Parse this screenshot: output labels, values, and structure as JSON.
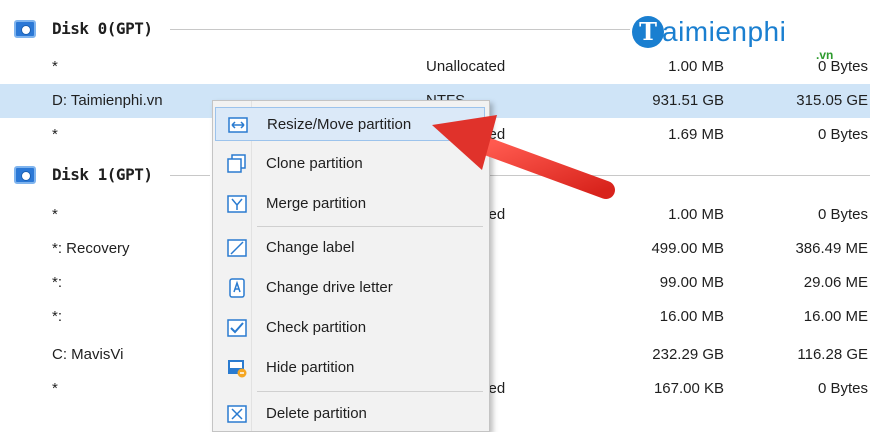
{
  "logo": {
    "mark": "T",
    "text": "aimienphi",
    "sub": ".vn"
  },
  "disks": [
    {
      "title": "Disk 0(GPT)",
      "rows": [
        {
          "name": "*",
          "fs": "Unallocated",
          "capacity": "1.00 MB",
          "used": "0 Bytes"
        },
        {
          "name": "D: Taimienphi.vn",
          "fs": "NTFS",
          "capacity": "931.51 GB",
          "used": "315.05 GE",
          "selected": true
        },
        {
          "name": "*",
          "fs": "Unallocated",
          "capacity": "1.69 MB",
          "used": "0 Bytes"
        }
      ]
    },
    {
      "title": "Disk 1(GPT)",
      "rows": [
        {
          "name": "*",
          "fs": "Unallocated",
          "capacity": "1.00 MB",
          "used": "0 Bytes"
        },
        {
          "name": "*: Recovery",
          "fs": "",
          "capacity": "499.00 MB",
          "used": "386.49 ME"
        },
        {
          "name": "*:",
          "fs": "",
          "capacity": "99.00 MB",
          "used": "29.06 ME"
        },
        {
          "name": "*:",
          "fs": "",
          "capacity": "16.00 MB",
          "used": "16.00 ME"
        },
        {
          "name": "C: MavisVi",
          "fs": "",
          "capacity": "232.29 GB",
          "used": "116.28 GE"
        },
        {
          "name": "*",
          "fs": "Unallocated",
          "capacity": "167.00 KB",
          "used": "0 Bytes"
        }
      ]
    }
  ],
  "context_menu": {
    "items": [
      {
        "label": "Resize/Move partition",
        "icon": "resize-icon"
      },
      {
        "label": "Clone partition",
        "icon": "clone-icon"
      },
      {
        "label": "Merge partition",
        "icon": "merge-icon"
      },
      {
        "label": "Change label",
        "icon": "edit-label-icon"
      },
      {
        "label": "Change drive letter",
        "icon": "drive-letter-icon"
      },
      {
        "label": "Check partition",
        "icon": "check-icon"
      },
      {
        "label": "Hide partition",
        "icon": "hide-icon"
      },
      {
        "label": "Delete partition",
        "icon": "delete-icon"
      }
    ]
  },
  "colors": {
    "accent": "#2b78d6",
    "selection": "#cfe4f7",
    "arrow": "#e53935",
    "logo": "#1a7fd0"
  }
}
